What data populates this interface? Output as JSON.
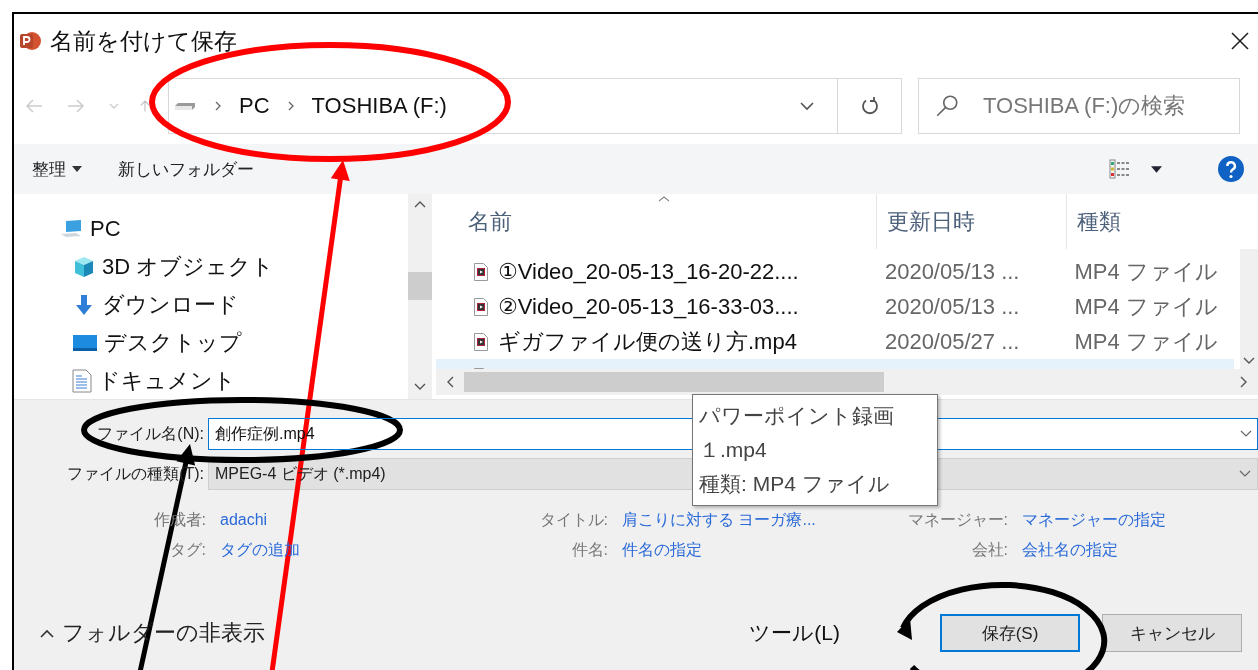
{
  "window": {
    "title": "名前を付けて保存"
  },
  "nav": {
    "path": [
      "PC",
      "TOSHIBA (F:)"
    ],
    "search": {
      "placeholder": "TOSHIBA (F:)の検索"
    }
  },
  "toolbar": {
    "organize": "整理",
    "new_folder": "新しいフォルダー"
  },
  "tree": [
    {
      "label": "PC",
      "kind": "pc",
      "children": [
        {
          "label": "3D オブジェクト",
          "kind": "cube"
        },
        {
          "label": "ダウンロード",
          "kind": "download"
        },
        {
          "label": "デスクトップ",
          "kind": "desktop"
        },
        {
          "label": "ドキュメント",
          "kind": "document"
        }
      ]
    }
  ],
  "columns": [
    "名前",
    "更新日時",
    "種類"
  ],
  "files": [
    {
      "name": "①Video_20-05-13_16-20-22....",
      "modified": "2020/05/13 ...",
      "type": "MP4 ファイル",
      "selected": false
    },
    {
      "name": "②Video_20-05-13_16-33-03....",
      "modified": "2020/05/13 ...",
      "type": "MP4 ファイル",
      "selected": false
    },
    {
      "name": "ギガファイル便の送り方.mp4",
      "modified": "2020/05/27 ...",
      "type": "MP4 ファイル",
      "selected": false
    },
    {
      "selected": true
    }
  ],
  "file_name": {
    "label": "ファイル名(N):",
    "value": "創作症例.mp4"
  },
  "file_type": {
    "label": "ファイルの種類(T):",
    "value": "MPEG-4 ビデオ (*.mp4)"
  },
  "metadata": [
    [
      {
        "label": "作成者:",
        "value": "adachi"
      },
      {
        "label": "タグ:",
        "value": "タグの追加"
      }
    ],
    [
      {
        "label": "タイトル:",
        "value": "肩こりに対する ヨーガ療..."
      },
      {
        "label": "件名:",
        "value": "件名の指定"
      }
    ],
    [
      {
        "label": "マネージャー:",
        "value": "マネージャーの指定"
      },
      {
        "label": "会社:",
        "value": "会社名の指定"
      }
    ]
  ],
  "footer": {
    "hide_folders": "フォルダーの非表示",
    "tools": "ツール(L)",
    "buttons": [
      {
        "label": "保存(S)",
        "default": true
      },
      {
        "label": "キャンセル",
        "default": false
      }
    ]
  },
  "tooltip": [
    "パワーポイント録画",
    "１.mp4",
    "種類: MP4 ファイル"
  ],
  "annotations": [
    {
      "kind": "ellipse",
      "color": "#ff0000"
    },
    {
      "kind": "arrow",
      "color": "#ff0000"
    },
    {
      "kind": "ellipse",
      "color": "#000000"
    },
    {
      "kind": "arrow",
      "color": "#000000"
    },
    {
      "kind": "ring-arrow",
      "color": "#000000"
    }
  ]
}
